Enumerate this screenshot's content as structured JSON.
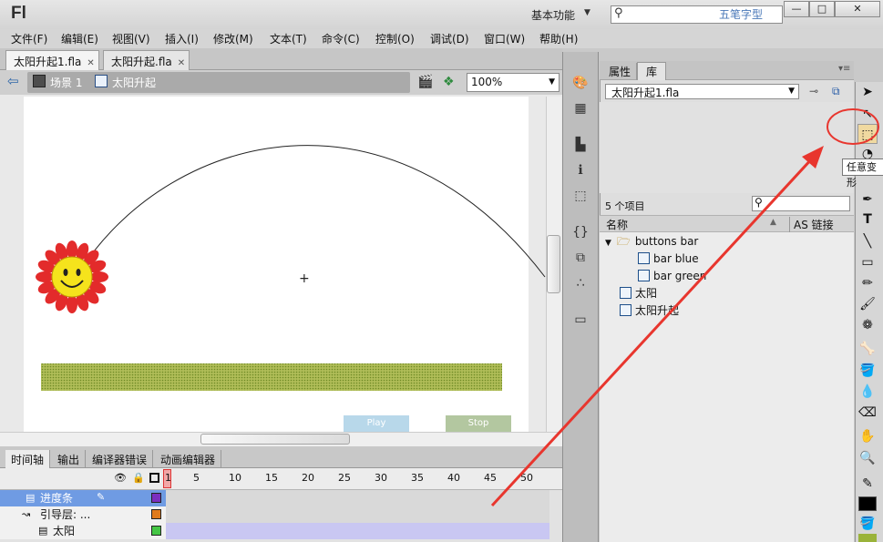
{
  "app": {
    "logo": "Fl",
    "workspace": "基本功能",
    "search_placeholder": "",
    "watermark": "五笔字型",
    "window_controls": [
      "—",
      "□",
      "✕"
    ]
  },
  "menu": [
    "文件(F)",
    "编辑(E)",
    "视图(V)",
    "插入(I)",
    "修改(M)",
    "文本(T)",
    "命令(C)",
    "控制(O)",
    "调试(D)",
    "窗口(W)",
    "帮助(H)"
  ],
  "doc_tabs": [
    {
      "label": "太阳升起1.fla",
      "active": true
    },
    {
      "label": "太阳升起.fla",
      "active": false
    }
  ],
  "edit_bar": {
    "scene": "场景 1",
    "symbol": "太阳升起",
    "zoom": "100%"
  },
  "stage": {
    "buttons": [
      "Play",
      "Stop"
    ],
    "colors": {
      "grass": "#94a83a",
      "play": "#b8d8ea",
      "stop": "#b3c7a0",
      "sun_petals": "#e32b2b",
      "sun_face": "#f7e51f"
    }
  },
  "timeline": {
    "tabs": [
      "时间轴",
      "输出",
      "编译器错误",
      "动画编辑器"
    ],
    "frame_numbers": [
      "1",
      "5",
      "10",
      "15",
      "20",
      "25",
      "30",
      "35",
      "40",
      "45",
      "50"
    ],
    "layers": [
      {
        "name": "进度条",
        "selected": true,
        "color": "#7b2fbf"
      },
      {
        "name": "引导层: ...",
        "selected": false,
        "color": "#e07a1b"
      },
      {
        "name": "太阳",
        "selected": false,
        "color": "#45c645"
      }
    ]
  },
  "library": {
    "tabs": [
      "属性",
      "库"
    ],
    "document": "太阳升起1.fla",
    "item_count": "5 个项目",
    "col_name": "名称",
    "col_link": "AS 链接",
    "items": [
      {
        "label": "buttons bar",
        "kind": "folder",
        "indent": 0
      },
      {
        "label": "bar blue",
        "kind": "button",
        "indent": 1
      },
      {
        "label": "bar green",
        "kind": "button",
        "indent": 1
      },
      {
        "label": "太阳",
        "kind": "graphic",
        "indent": 0
      },
      {
        "label": "太阳升起",
        "kind": "movieclip",
        "indent": 0
      }
    ]
  },
  "tooltip": "任意变形"
}
